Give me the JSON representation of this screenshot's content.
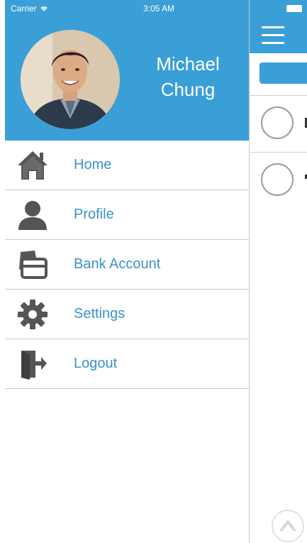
{
  "status_bar": {
    "carrier": "Carrier",
    "time": "3:05 AM"
  },
  "profile": {
    "first_name": "Michael",
    "last_name": "Chung"
  },
  "menu": {
    "items": [
      {
        "label": "Home",
        "icon": "home-icon"
      },
      {
        "label": "Profile",
        "icon": "user-icon"
      },
      {
        "label": "Bank Account",
        "icon": "bank-card-icon"
      },
      {
        "label": "Settings",
        "icon": "gear-icon"
      },
      {
        "label": "Logout",
        "icon": "logout-icon"
      }
    ]
  },
  "colors": {
    "accent": "#3a9fd6",
    "label": "#3a93c9",
    "icon": "#555555"
  }
}
